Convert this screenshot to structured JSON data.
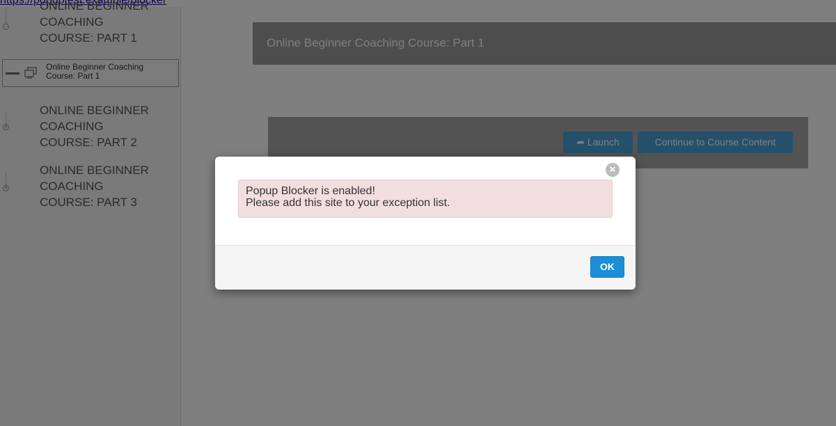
{
  "top_link": {
    "text": "https://popuptest.example/blocker"
  },
  "sidebar": {
    "sections": [
      {
        "title_lines": [
          "ONLINE BEGINNER",
          "COACHING",
          "COURSE: PART 1"
        ]
      },
      {
        "title_lines": [
          "ONLINE BEGINNER",
          "COACHING",
          "COURSE: PART 2"
        ]
      },
      {
        "title_lines": [
          "ONLINE BEGINNER",
          "COACHING",
          "COURSE: PART 3"
        ]
      }
    ],
    "active_item": {
      "label": "Online Beginner Coaching Course: Part 1",
      "icon": "screen-icon"
    }
  },
  "main": {
    "header_title": "Online Beginner Coaching Course: Part 1",
    "launch_label": "Launch",
    "launch_icon": "share-arrow-icon",
    "continue_label": "Continue to Course Content"
  },
  "modal": {
    "alert_line1": "Popup Blocker is enabled!",
    "alert_line2": "Please add this site to your exception list.",
    "ok_label": "OK",
    "close_icon": "close-icon"
  },
  "colors": {
    "overlay": "#000000",
    "alert_bg": "#f2dede",
    "ok_button": "#1a8fd6",
    "header_bar": "#9b9b9b"
  }
}
